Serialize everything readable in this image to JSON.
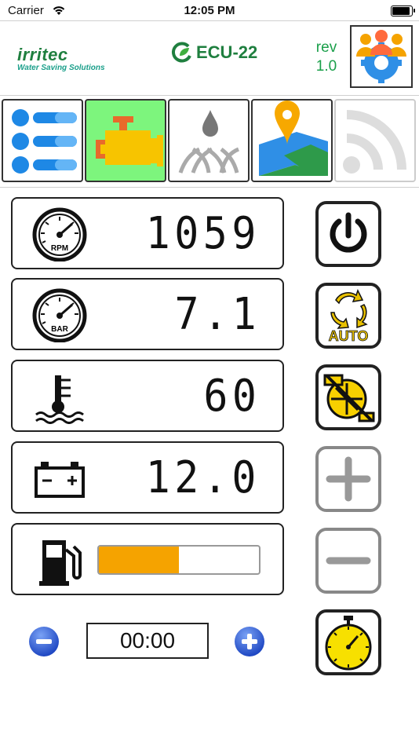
{
  "status": {
    "carrier": "Carrier",
    "time": "12:05 PM"
  },
  "header": {
    "brand_name": "irritec",
    "brand_tagline": "Water Saving Solutions",
    "product_name": "ECU-22",
    "rev_label": "rev",
    "rev_value": "1.0",
    "user_icon": "users-gear-icon"
  },
  "tabs": [
    {
      "name": "list",
      "icon": "list-icon",
      "active": false
    },
    {
      "name": "engine",
      "icon": "engine-icon",
      "active": true
    },
    {
      "name": "irrigation",
      "icon": "irrigation-drop-icon",
      "active": false
    },
    {
      "name": "map",
      "icon": "map-pin-icon",
      "active": false
    },
    {
      "name": "signal",
      "icon": "wifi-signal-icon",
      "active": false
    }
  ],
  "gauges": {
    "rpm": {
      "label": "RPM",
      "value": "1059"
    },
    "pressure": {
      "label": "BAR",
      "value": "7.1"
    },
    "temperature": {
      "value": "60"
    },
    "battery": {
      "value": "12.0"
    },
    "fuel": {
      "level_percent": 50
    }
  },
  "controls": {
    "power": "power-icon",
    "auto_label": "AUTO",
    "pump": "pump-off-icon",
    "plus": "plus-icon",
    "minus": "minus-icon",
    "stopwatch": "stopwatch-icon"
  },
  "timer": {
    "value": "00:00"
  },
  "colors": {
    "accent_green": "#7df57d",
    "fuel_orange": "#f5a300",
    "brand_green": "#1f7f3f",
    "round_blue": "#2a5bd7"
  }
}
